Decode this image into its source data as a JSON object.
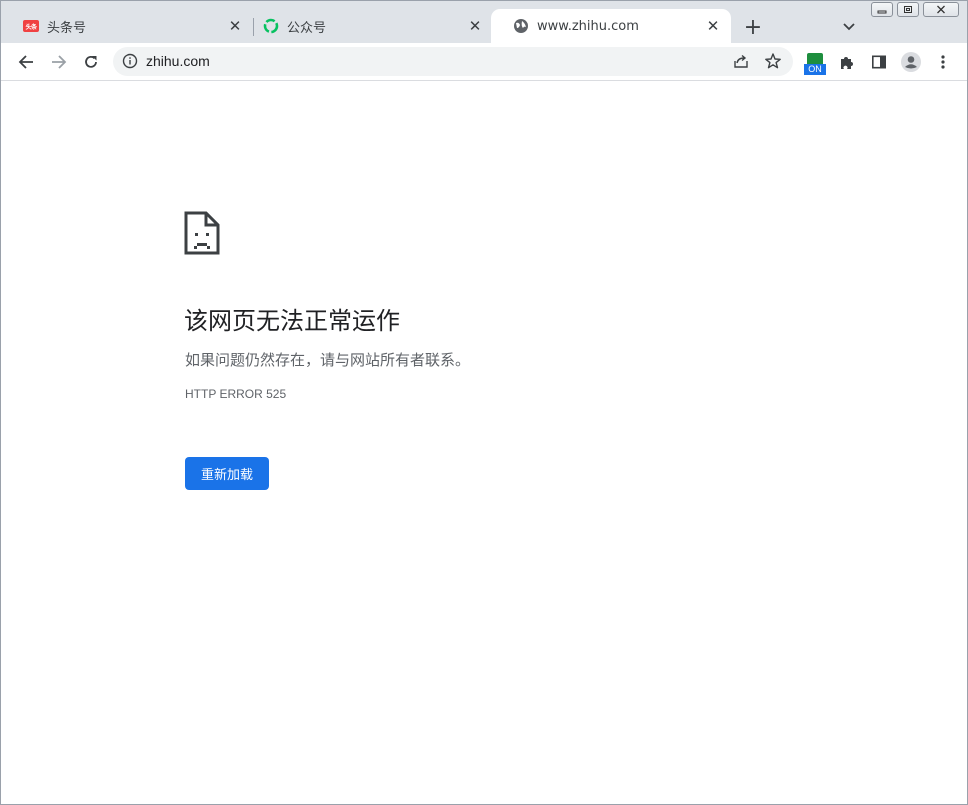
{
  "tabs": [
    {
      "title": "头条号",
      "favicon": "toutiao-logo",
      "favicon_text": "头条",
      "active": false
    },
    {
      "title": "公众号",
      "favicon": "wechat-mp-logo",
      "active": false
    },
    {
      "title": "www.zhihu.com",
      "favicon": "globe-icon",
      "active": true
    }
  ],
  "tab_close_glyph": "✕",
  "new_tab_glyph": "+",
  "toolbar": {
    "url": "zhihu.com",
    "extension_badge": "ON"
  },
  "error_page": {
    "heading": "该网页无法正常运作",
    "description": "如果问题仍然存在，请与网站所有者联系。",
    "error_code": "HTTP ERROR 525",
    "reload_label": "重新加载"
  },
  "colors": {
    "tabstrip": "#dfe3e8",
    "primary_button": "#1a73e8",
    "toutiao_red": "#f04142",
    "wechat_green": "#07c160"
  }
}
